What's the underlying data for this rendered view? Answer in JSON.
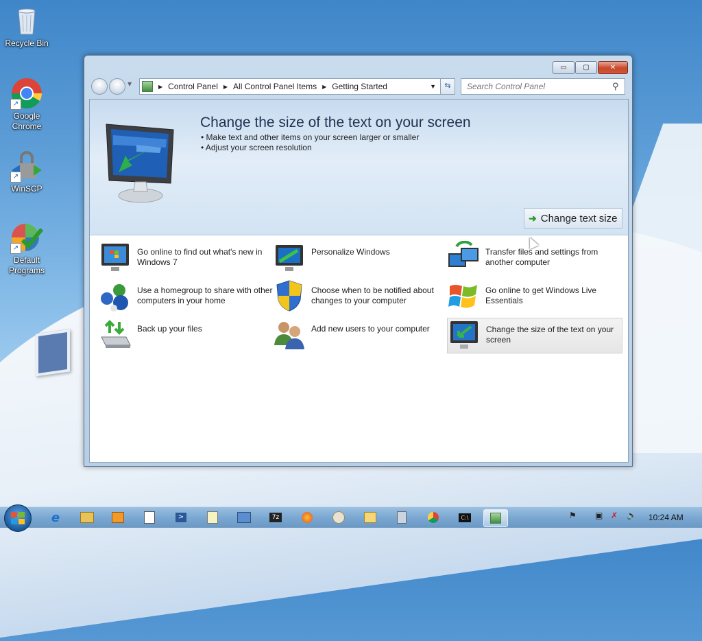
{
  "desktop": {
    "icons": [
      {
        "label": "Recycle Bin",
        "icon": "recycle-bin-icon"
      },
      {
        "label": "Google Chrome",
        "icon": "chrome-icon"
      },
      {
        "label": "WinSCP",
        "icon": "winscp-icon"
      },
      {
        "label": "Default Programs",
        "icon": "default-programs-icon"
      }
    ]
  },
  "window": {
    "title_buttons": {
      "minimize": "▭",
      "maximize": "▢",
      "close": "✕"
    },
    "breadcrumb": [
      "Control Panel",
      "All Control Panel Items",
      "Getting Started"
    ],
    "search_placeholder": "Search Control Panel",
    "hero": {
      "title": "Change the size of the text on your screen",
      "bullets": [
        "Make text and other items on your screen larger or smaller",
        "Adjust your screen resolution"
      ],
      "button_label": "Change text size"
    },
    "tasks": [
      {
        "label": "Go online to find out what's new in Windows 7",
        "icon": "whats-new-icon"
      },
      {
        "label": "Personalize Windows",
        "icon": "personalize-icon"
      },
      {
        "label": "Transfer files and settings from another computer",
        "icon": "transfer-icon"
      },
      {
        "label": "Use a homegroup to share with other computers in your home",
        "icon": "homegroup-icon"
      },
      {
        "label": "Choose when to be notified about changes to your computer",
        "icon": "uac-shield-icon"
      },
      {
        "label": "Go online to get Windows Live Essentials",
        "icon": "windows-live-icon"
      },
      {
        "label": "Back up your files",
        "icon": "backup-icon"
      },
      {
        "label": "Add new users to your computer",
        "icon": "users-icon"
      },
      {
        "label": "Change the size of the text on your screen",
        "icon": "display-icon",
        "selected": true
      }
    ]
  },
  "taskbar": {
    "clock": "10:24 AM",
    "apps": [
      "internet-explorer-icon",
      "explorer-icon",
      "media-player-icon",
      "app-icon",
      "powershell-icon",
      "notepad-icon",
      "network-icon",
      "7zip-icon",
      "firefox-icon",
      "paint-icon",
      "folder-icon",
      "calculator-icon",
      "chrome-icon",
      "cmd-icon",
      "control-panel-icon"
    ],
    "tray": [
      "action-center-icon",
      "network-status-icon",
      "volume-icon"
    ]
  }
}
